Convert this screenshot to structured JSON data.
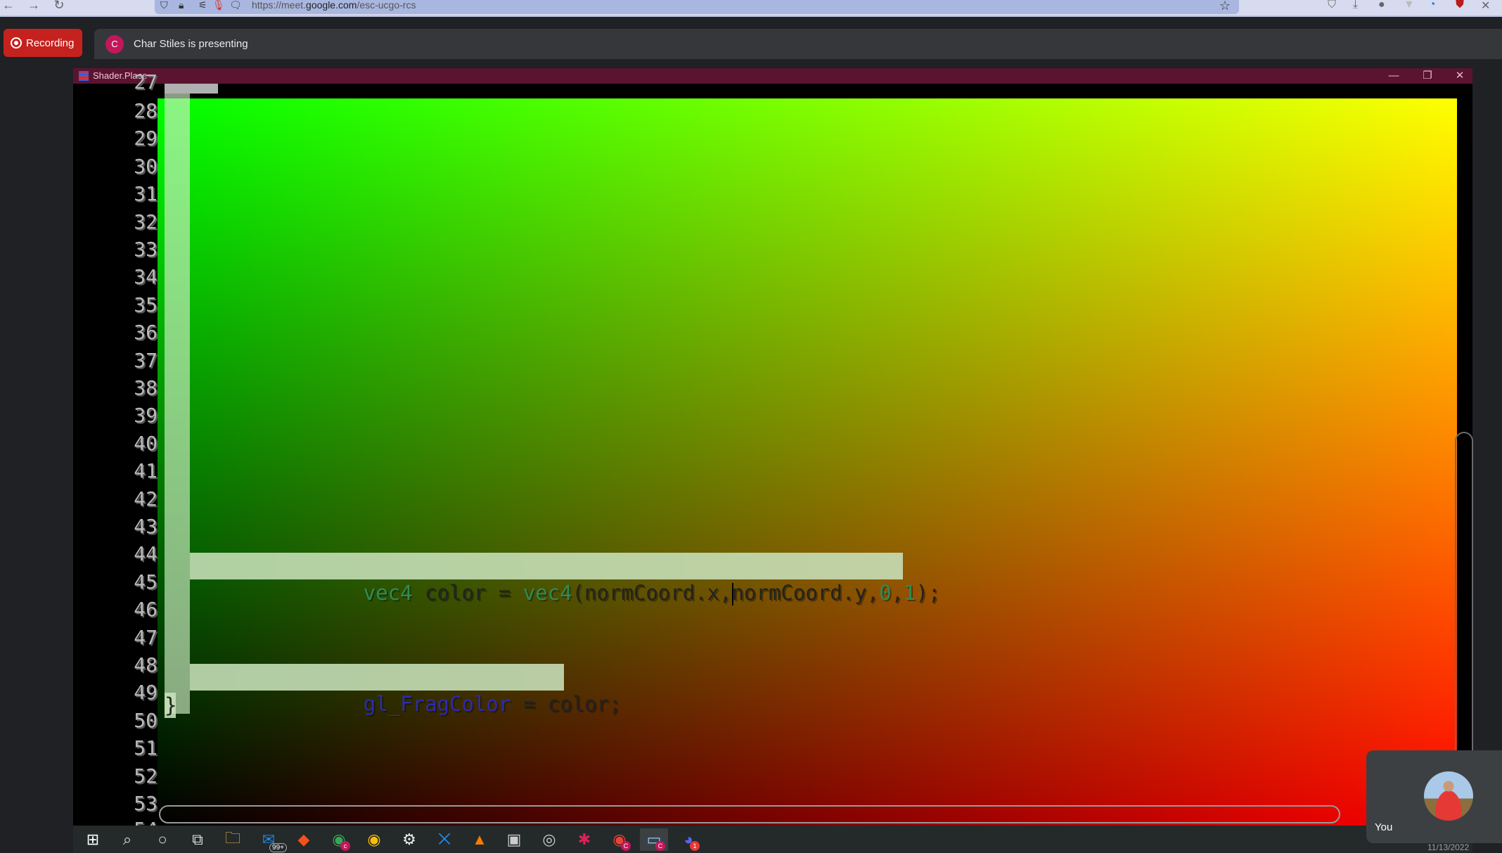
{
  "browser": {
    "nav": {
      "back_icon": "←",
      "forward_icon": "→",
      "reload_icon": "↻"
    },
    "url_prefix": "https://meet.",
    "url_domain": "google.com",
    "url_path": "/esc-ucgo-rcs",
    "url_icons": [
      "shield-icon",
      "lock-icon",
      "permissions-icon",
      "microphone-icon",
      "notes-icon"
    ],
    "extensions": [
      "pocket-icon",
      "download-icon",
      "profile-icon",
      "extension-icon",
      "vpn-icon",
      "ublock-icon",
      "pin-icon"
    ]
  },
  "meet": {
    "recording_label": "Recording",
    "presenter_initial": "C",
    "presenting_text": "Char Stiles is presenting",
    "self_label": "You"
  },
  "shader_window": {
    "title": "Shader.Place",
    "controls": {
      "minimize": "—",
      "restore": "❐",
      "close": "✕"
    }
  },
  "editor": {
    "first_partial_line": "27",
    "line_numbers": [
      "28",
      "29",
      "30",
      "31",
      "32",
      "33",
      "34",
      "35",
      "36",
      "37",
      "38",
      "39",
      "40",
      "41",
      "42",
      "43",
      "44",
      "45",
      "46",
      "47",
      "48",
      "49",
      "50",
      "51",
      "52",
      "53"
    ],
    "last_partial_line": "54",
    "code": {
      "line42": {
        "number": "42",
        "tokens": [
          {
            "type": "kw",
            "text": "vec4"
          },
          {
            "type": "id",
            "text": " color = "
          },
          {
            "type": "kw",
            "text": "vec4"
          },
          {
            "type": "id",
            "text": "(normCoord.x,"
          },
          {
            "type": "cursor",
            "text": ""
          },
          {
            "type": "id",
            "text": "normCoord.y,"
          },
          {
            "type": "num",
            "text": "0"
          },
          {
            "type": "id",
            "text": ","
          },
          {
            "type": "num",
            "text": "1"
          },
          {
            "type": "id",
            "text": ");"
          }
        ]
      },
      "line46": {
        "number": "46",
        "tokens": [
          {
            "type": "builtin",
            "text": "gl_FragColor"
          },
          {
            "type": "id",
            "text": " = color;"
          }
        ]
      },
      "line47": {
        "number": "47",
        "text": "}"
      }
    },
    "colors": {
      "keyword": "#2e8b57",
      "identifier": "#222222",
      "builtin": "#2c2ca8",
      "highlight": "#c8e1b9"
    }
  },
  "taskbar": {
    "items": [
      {
        "name": "start-icon",
        "glyph": "⊞"
      },
      {
        "name": "search-icon",
        "glyph": "⌕"
      },
      {
        "name": "cortana-icon",
        "glyph": "○"
      },
      {
        "name": "task-view-icon",
        "glyph": "⧉"
      },
      {
        "name": "file-explorer-icon",
        "glyph": "🗀"
      },
      {
        "name": "mail-icon",
        "glyph": "✉",
        "count": "99+"
      },
      {
        "name": "git-icon",
        "glyph": "◆"
      },
      {
        "name": "chrome-profile-icon",
        "glyph": "◉",
        "badge": "c"
      },
      {
        "name": "chrome-icon",
        "glyph": "◉"
      },
      {
        "name": "settings-icon",
        "glyph": "⚙"
      },
      {
        "name": "vscode-icon",
        "glyph": "⨉"
      },
      {
        "name": "vlc-icon",
        "glyph": "▲"
      },
      {
        "name": "app-icon",
        "glyph": "▣"
      },
      {
        "name": "obs-icon",
        "glyph": "◎"
      },
      {
        "name": "slack-icon",
        "glyph": "✱"
      },
      {
        "name": "chrome-c-icon",
        "glyph": "◉",
        "badge": "C"
      },
      {
        "name": "window-c-icon",
        "glyph": "▭",
        "badge": "C",
        "active": true
      },
      {
        "name": "discord-icon",
        "glyph": "◕",
        "badge": "1"
      }
    ],
    "date": "11/13/2022"
  },
  "accent_colors": {
    "recording": "#c5221f",
    "titlebar": "#5a1430",
    "presenter_avatar": "#c2185b"
  }
}
